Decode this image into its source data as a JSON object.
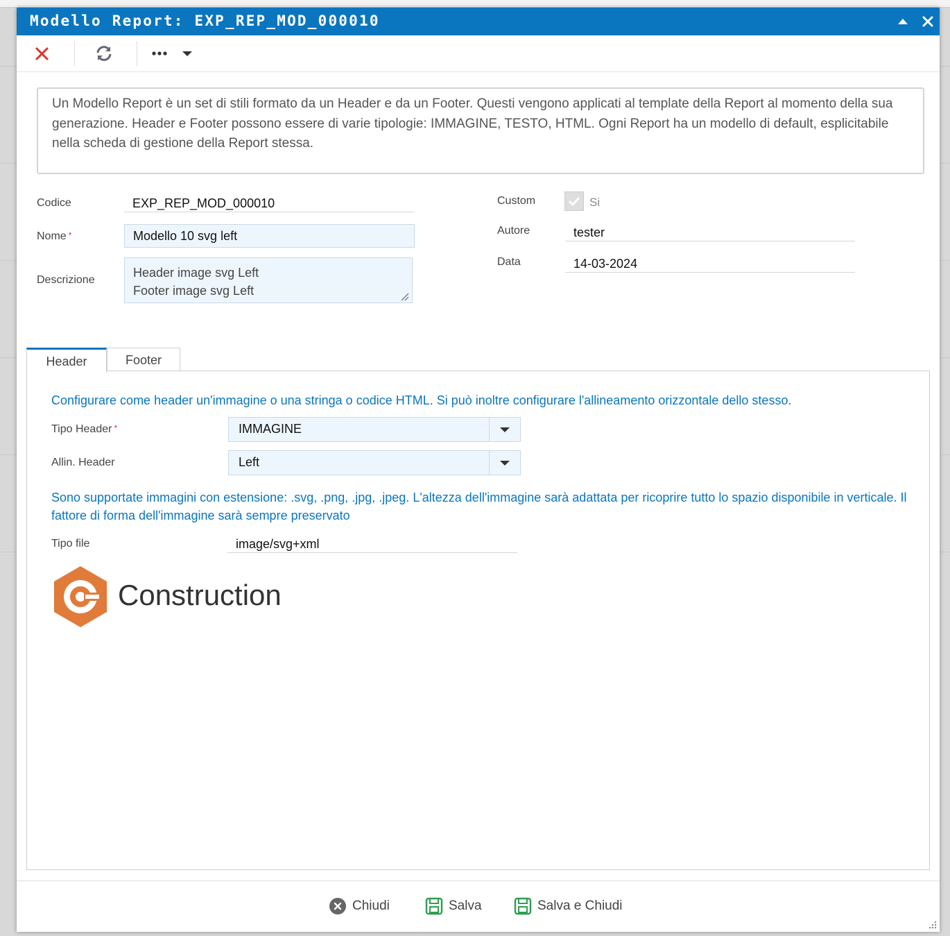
{
  "dialog": {
    "title": "Modello Report: EXP_REP_MOD_000010"
  },
  "toolbar": {
    "items": [
      "close-icon",
      "refresh-icon",
      "more-icon",
      "chevron-down-icon"
    ]
  },
  "info_text": "Un Modello Report è un set di stili formato da un Header e da un Footer. Questi vengono applicati al template della Report al momento della sua generazione. Header e Footer possono essere di varie tipologie: IMMAGINE, TESTO, HTML. Ogni Report ha un modello di default, esplicitabile nella scheda di gestione della Report stessa.",
  "form": {
    "codice_label": "Codice",
    "codice_value": "EXP_REP_MOD_000010",
    "nome_label": "Nome",
    "required_mark": "*",
    "nome_value": "Modello 10 svg left",
    "descrizione_label": "Descrizione",
    "descrizione_value": "Header image svg Left\nFooter  image svg Left",
    "custom_label": "Custom",
    "custom_checkbox_label": "Si",
    "autore_label": "Autore",
    "autore_value": "tester",
    "data_label": "Data",
    "data_value": "14-03-2024"
  },
  "tabs": [
    {
      "label": "Header",
      "active": true
    },
    {
      "label": "Footer",
      "active": false
    }
  ],
  "header_tab": {
    "note_top": "Configurare come header un'immagine o una stringa o codice HTML. Si può inoltre configurare l'allineamento orizzontale dello stesso.",
    "tipo_label": "Tipo Header",
    "tipo_value": "IMMAGINE",
    "allin_label": "Allin. Header",
    "allin_value": "Left",
    "note_image": "Sono supportate immagini con estensione: .svg, .png, .jpg, .jpeg. L'altezza dell'immagine sarà adattata per ricoprire tutto lo spazio disponibile in verticale. Il fattore di forma dell'immagine sarà sempre preservato",
    "tipo_file_label": "Tipo file",
    "tipo_file_value": "image/svg+xml",
    "preview_logo_text": "Construction"
  },
  "footer_buttons": {
    "chiudi": "Chiudi",
    "salva": "Salva",
    "salva_chiudi": "Salva e Chiudi"
  },
  "colors": {
    "accent": "#0a76bf",
    "logo_orange": "#e07b39",
    "close_red": "#d9342b"
  }
}
